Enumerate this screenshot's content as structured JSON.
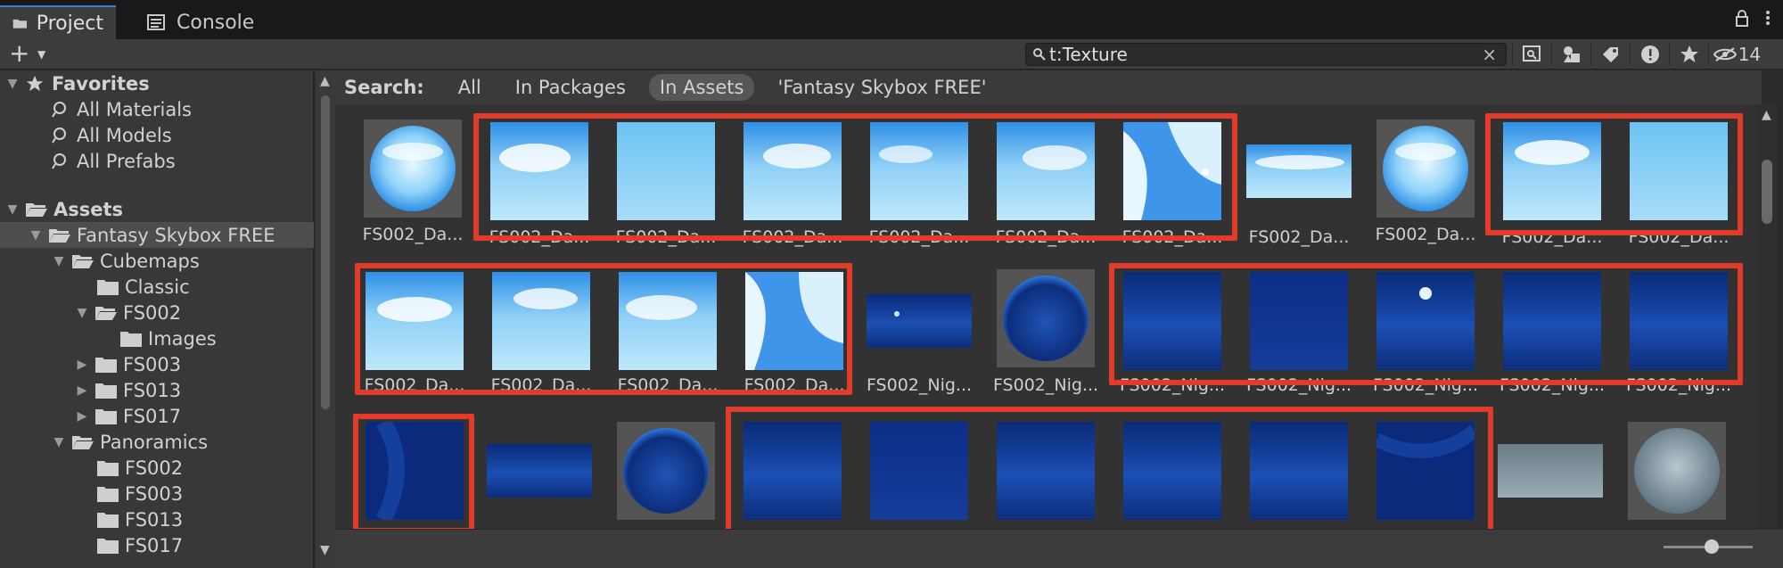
{
  "tabs": [
    {
      "label": "Project",
      "icon": "folder-icon"
    },
    {
      "label": "Console",
      "icon": "console-icon"
    }
  ],
  "toolbar": {
    "add_label": "+",
    "search_value": "t:Texture",
    "hidden_count": "14"
  },
  "tree": {
    "favorites_label": "Favorites",
    "favorites": [
      "All Materials",
      "All Models",
      "All Prefabs"
    ],
    "assets_label": "Assets",
    "items": [
      {
        "label": "Fantasy Skybox FREE"
      },
      {
        "label": "Cubemaps"
      },
      {
        "label": "Classic"
      },
      {
        "label": "FS002"
      },
      {
        "label": "Images"
      },
      {
        "label": "FS003"
      },
      {
        "label": "FS013"
      },
      {
        "label": "FS017"
      },
      {
        "label": "Panoramics"
      },
      {
        "label": "FS002"
      },
      {
        "label": "FS003"
      },
      {
        "label": "FS013"
      },
      {
        "label": "FS017"
      }
    ]
  },
  "searchbar": {
    "label": "Search:",
    "scopes": [
      "All",
      "In Packages",
      "In Assets",
      "'Fantasy Skybox FREE'"
    ]
  },
  "grid": {
    "row1": [
      "FS002_Da...",
      "FS002_Da...",
      "FS002_Da...",
      "FS002_Da...",
      "FS002_Da...",
      "FS002_Da...",
      "FS002_Da...",
      "FS002_Da...",
      "FS002_Da...",
      "FS002_Da...",
      "FS002_Da..."
    ],
    "row2": [
      "FS002_Da...",
      "FS002_Da...",
      "FS002_Da...",
      "FS002_Da...",
      "FS002_Nig...",
      "FS002_Nig...",
      "FS002_Nig...",
      "FS002_Nig...",
      "FS002_Nig...",
      "FS002_Nig...",
      "FS002_Nig..."
    ]
  },
  "colors": {
    "highlight": "#e23b2a",
    "accent": "#3a7fd6"
  }
}
